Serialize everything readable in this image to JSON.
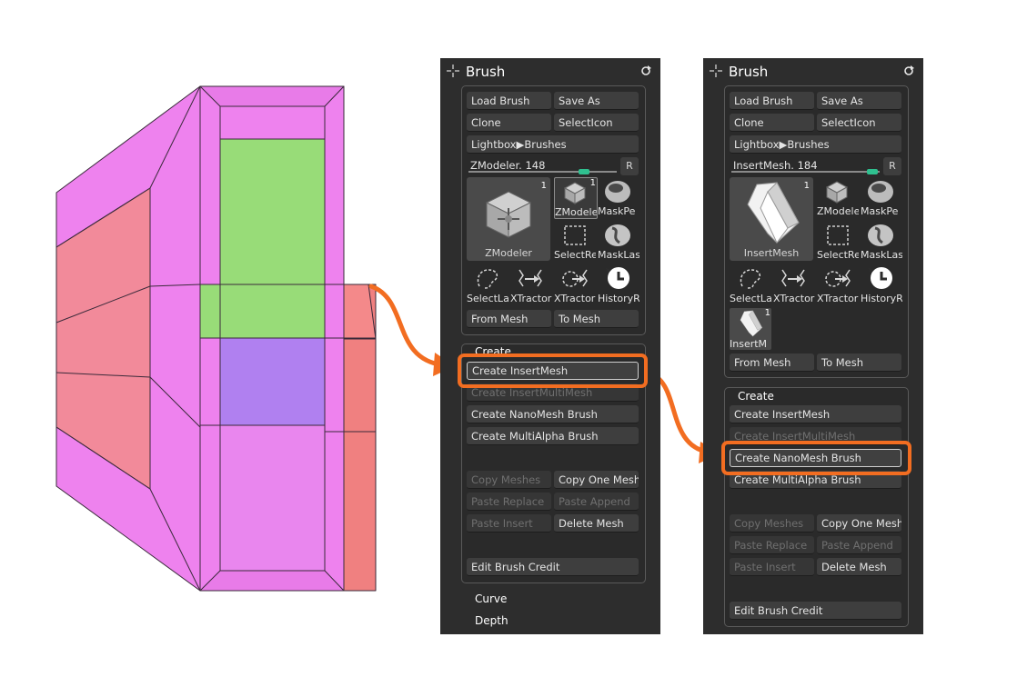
{
  "colors": {
    "accent": "#f26d21",
    "panel_bg": "#2d2d2d",
    "button_bg": "#3e3e3e",
    "slider_knob": "#2fc08f",
    "mesh_pink": "#ee82ee",
    "mesh_green": "#98dc78",
    "mesh_purple": "#b080f0",
    "mesh_salmon": "#f08080"
  },
  "panel1": {
    "title": "Brush",
    "load_brush": "Load Brush",
    "save_as": "Save As",
    "clone": "Clone",
    "select_icon": "SelectIcon",
    "lightbox": "Lightbox▶Brushes",
    "slider_label": "ZModeler. 148",
    "slider_value": 0.6,
    "r_button": "R",
    "current_brush": "ZModeler",
    "current_count": "1",
    "thumbs": [
      {
        "label": "ZModele",
        "count": "1",
        "icon": "zmodeler-cube-icon"
      },
      {
        "label": "MaskPe",
        "icon": "mask-pen-icon"
      },
      {
        "label": "SelectRe",
        "icon": "select-rect-icon"
      },
      {
        "label": "MaskLas",
        "icon": "mask-lasso-icon"
      },
      {
        "label": "SelectLa",
        "icon": "select-lasso-icon"
      },
      {
        "label": "XTractor",
        "icon": "xtractor-icon"
      },
      {
        "label": "XTractor",
        "icon": "xtractor-alt-icon"
      },
      {
        "label": "HistoryR",
        "icon": "history-recall-icon"
      }
    ],
    "from_mesh": "From Mesh",
    "to_mesh": "To Mesh",
    "create_header": "Create",
    "create_insertmesh": "Create InsertMesh",
    "create_insertmultimesh": "Create InsertMultiMesh",
    "create_nanomesh": "Create NanoMesh Brush",
    "create_multialpha": "Create MultiAlpha Brush",
    "copy_meshes": "Copy Meshes",
    "copy_one_mesh": "Copy One Mesh",
    "paste_replace": "Paste Replace",
    "paste_append": "Paste Append",
    "paste_insert": "Paste Insert",
    "delete_mesh": "Delete Mesh",
    "edit_brush_credit": "Edit Brush Credit",
    "curve": "Curve",
    "depth": "Depth"
  },
  "panel2": {
    "title": "Brush",
    "load_brush": "Load Brush",
    "save_as": "Save As",
    "clone": "Clone",
    "select_icon": "SelectIcon",
    "lightbox": "Lightbox▶Brushes",
    "slider_label": "InsertMesh. 184",
    "slider_value": 0.97,
    "r_button": "R",
    "current_brush": "InsertMesh",
    "current_count": "1",
    "thumbs": [
      {
        "label": "ZModele",
        "icon": "zmodeler-cube-icon"
      },
      {
        "label": "MaskPe",
        "icon": "mask-pen-icon"
      },
      {
        "label": "SelectRe",
        "icon": "select-rect-icon"
      },
      {
        "label": "MaskLas",
        "icon": "mask-lasso-icon"
      },
      {
        "label": "SelectLa",
        "icon": "select-lasso-icon"
      },
      {
        "label": "XTractor",
        "icon": "xtractor-icon"
      },
      {
        "label": "XTractor",
        "icon": "xtractor-alt-icon"
      },
      {
        "label": "HistoryR",
        "icon": "history-recall-icon"
      },
      {
        "label": "InsertM",
        "count": "1",
        "icon": "insertmesh-icon"
      }
    ],
    "from_mesh": "From Mesh",
    "to_mesh": "To Mesh",
    "create_header": "Create",
    "create_insertmesh": "Create InsertMesh",
    "create_insertmultimesh": "Create InsertMultiMesh",
    "create_nanomesh": "Create NanoMesh Brush",
    "create_multialpha": "Create MultiAlpha Brush",
    "copy_meshes": "Copy Meshes",
    "copy_one_mesh": "Copy One Mesh",
    "paste_replace": "Paste Replace",
    "paste_append": "Paste Append",
    "paste_insert": "Paste Insert",
    "delete_mesh": "Delete Mesh",
    "edit_brush_credit": "Edit Brush Credit"
  }
}
